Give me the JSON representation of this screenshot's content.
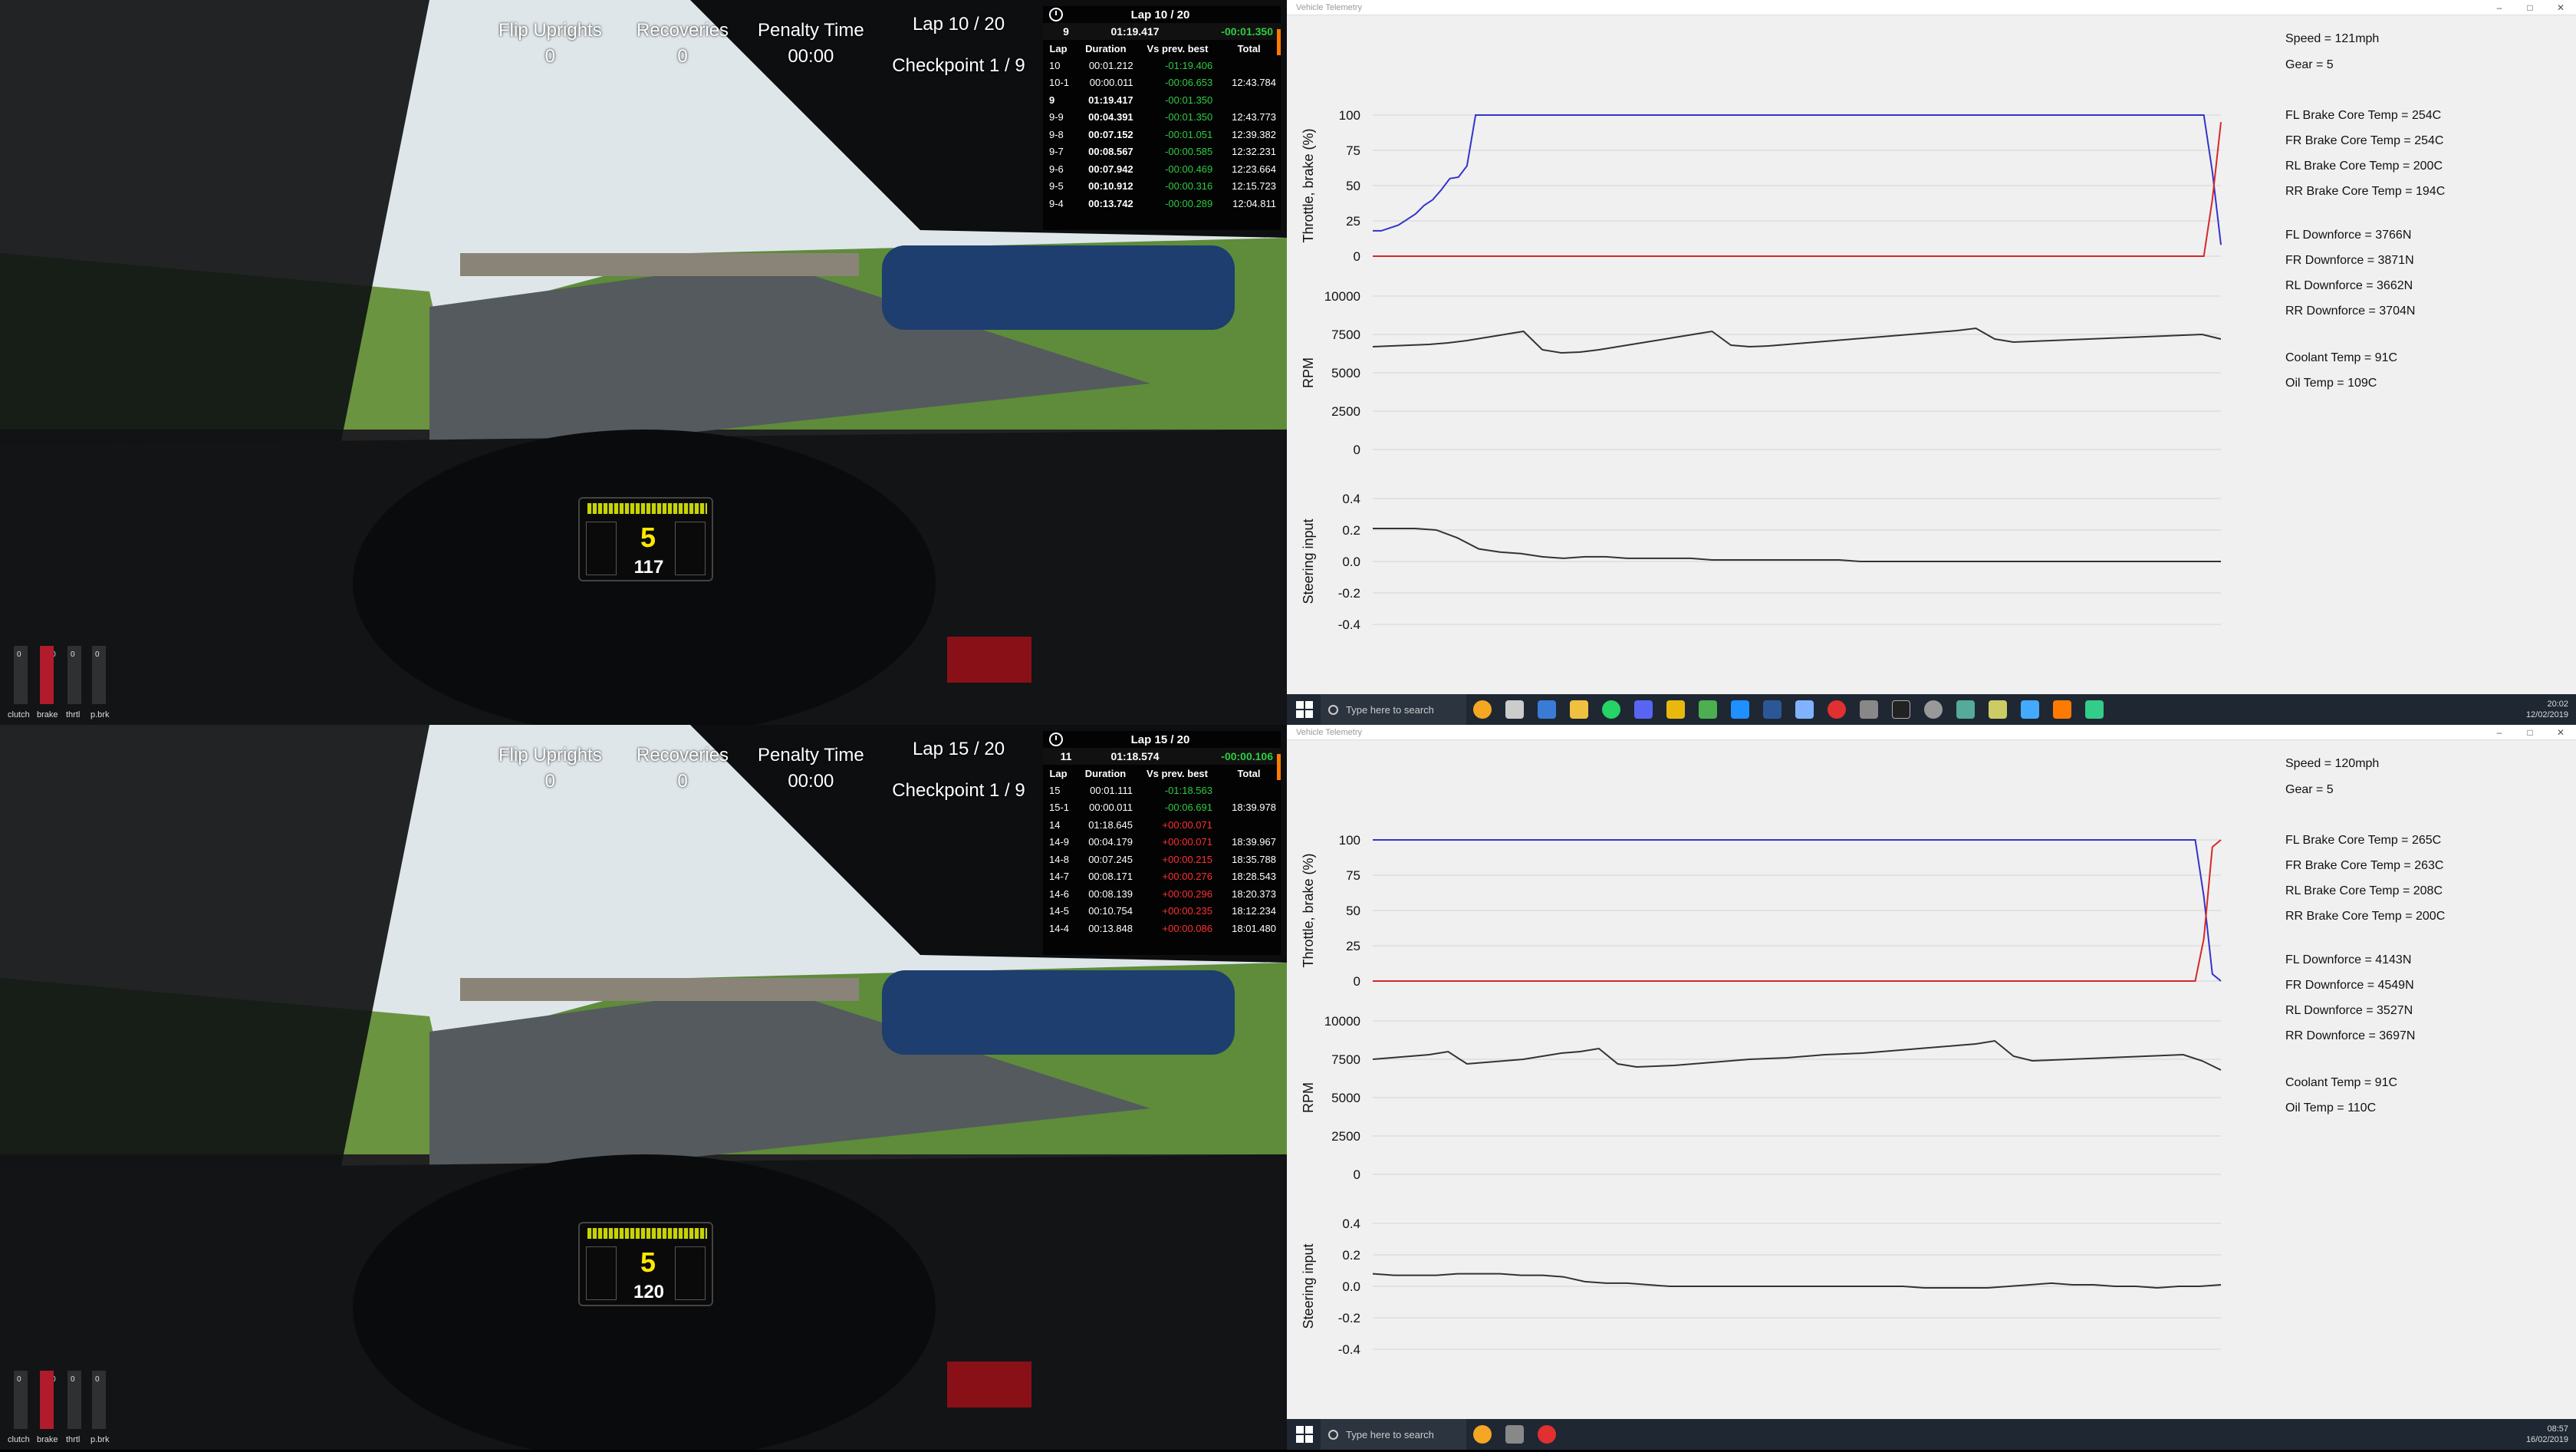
{
  "colors": {
    "throttle": "#3333cc",
    "brake": "#d62728",
    "rpm": "#333333",
    "steering": "#333333",
    "positive_delta": "#2ecc40",
    "negative_delta": "#ff3030",
    "rev_accent": "#c8d400",
    "gear_color": "#ffe800"
  },
  "top": {
    "hud": {
      "flip_uprights_label": "Flip Uprights",
      "flip_uprights_value": "0",
      "recoveries_label": "Recoveries",
      "recoveries_value": "0",
      "penalty_label": "Penalty Time",
      "penalty_value": "00:00",
      "lap": "Lap 10 / 20",
      "checkpoint": "Checkpoint 1 / 9"
    },
    "timing": {
      "header": "Lap 10 / 20",
      "current": {
        "lap": "9",
        "time": "01:19.417",
        "delta": "-00:01.350"
      },
      "columns": [
        "Lap",
        "Duration",
        "Vs prev. best",
        "Total"
      ],
      "rows": [
        {
          "lap": "10",
          "duration": "00:01.212",
          "delta": "-01:19.406",
          "total": ""
        },
        {
          "lap": "10-1",
          "duration": "00:00.011",
          "delta": "-00:06.653",
          "total": "12:43.784"
        },
        {
          "lap": "9",
          "duration": "01:19.417",
          "delta": "-00:01.350",
          "total": ""
        },
        {
          "lap": "9-9",
          "duration": "00:04.391",
          "delta": "-00:01.350",
          "total": "12:43.773"
        },
        {
          "lap": "9-8",
          "duration": "00:07.152",
          "delta": "-00:01.051",
          "total": "12:39.382"
        },
        {
          "lap": "9-7",
          "duration": "00:08.567",
          "delta": "-00:00.585",
          "total": "12:32.231"
        },
        {
          "lap": "9-6",
          "duration": "00:07.942",
          "delta": "-00:00.469",
          "total": "12:23.664"
        },
        {
          "lap": "9-5",
          "duration": "00:10.912",
          "delta": "-00:00.316",
          "total": "12:15.723"
        },
        {
          "lap": "9-4",
          "duration": "00:13.742",
          "delta": "-00:00.289",
          "total": "12:04.811"
        }
      ]
    },
    "dash": {
      "gear": "5",
      "speed": "117"
    },
    "pedals": {
      "labels": [
        "clutch",
        "brake",
        "thrtl",
        "p.brk"
      ],
      "values": [
        "0",
        "100",
        "0",
        "0"
      ]
    },
    "telemetry": {
      "title": "Vehicle Telemetry",
      "readouts_group1": [
        "Speed = 121mph",
        "Gear = 5"
      ],
      "readouts_group2": [
        "FL Brake Core Temp = 254C",
        "FR Brake Core Temp = 254C",
        "RL Brake Core Temp = 200C",
        "RR Brake Core Temp = 194C"
      ],
      "readouts_group3": [
        "FL Downforce = 3766N",
        "FR Downforce = 3871N",
        "RL Downforce = 3662N",
        "RR Downforce = 3704N"
      ],
      "readouts_group4": [
        "Coolant Temp = 91C",
        "Oil Temp = 109C"
      ],
      "taskbar_search": "Type here to search",
      "clock_time": "20:02",
      "clock_date": "12/02/2019"
    }
  },
  "bottom": {
    "hud": {
      "flip_uprights_label": "Flip Uprights",
      "flip_uprights_value": "0",
      "recoveries_label": "Recoveries",
      "recoveries_value": "0",
      "penalty_label": "Penalty Time",
      "penalty_value": "00:00",
      "lap": "Lap 15 / 20",
      "checkpoint": "Checkpoint 1 / 9"
    },
    "timing": {
      "header": "Lap 15 / 20",
      "current": {
        "lap": "11",
        "time": "01:18.574",
        "delta": "-00:00.106"
      },
      "columns": [
        "Lap",
        "Duration",
        "Vs prev. best",
        "Total"
      ],
      "rows": [
        {
          "lap": "15",
          "duration": "00:01.111",
          "delta": "-01:18.563",
          "total": ""
        },
        {
          "lap": "15-1",
          "duration": "00:00.011",
          "delta": "-00:06.691",
          "total": "18:39.978"
        },
        {
          "lap": "14",
          "duration": "01:18.645",
          "delta": "+00:00.071",
          "total": ""
        },
        {
          "lap": "14-9",
          "duration": "00:04.179",
          "delta": "+00:00.071",
          "total": "18:39.967"
        },
        {
          "lap": "14-8",
          "duration": "00:07.245",
          "delta": "+00:00.215",
          "total": "18:35.788"
        },
        {
          "lap": "14-7",
          "duration": "00:08.171",
          "delta": "+00:00.276",
          "total": "18:28.543"
        },
        {
          "lap": "14-6",
          "duration": "00:08.139",
          "delta": "+00:00.296",
          "total": "18:20.373"
        },
        {
          "lap": "14-5",
          "duration": "00:10.754",
          "delta": "+00:00.235",
          "total": "18:12.234"
        },
        {
          "lap": "14-4",
          "duration": "00:13.848",
          "delta": "+00:00.086",
          "total": "18:01.480"
        }
      ]
    },
    "dash": {
      "gear": "5",
      "speed": "120"
    },
    "pedals": {
      "labels": [
        "clutch",
        "brake",
        "thrtl",
        "p.brk"
      ],
      "values": [
        "0",
        "100",
        "0",
        "0"
      ]
    },
    "telemetry": {
      "title": "Vehicle Telemetry",
      "readouts_group1": [
        "Speed = 120mph",
        "Gear = 5"
      ],
      "readouts_group2": [
        "FL Brake Core Temp = 265C",
        "FR Brake Core Temp = 263C",
        "RL Brake Core Temp = 208C",
        "RR Brake Core Temp = 200C"
      ],
      "readouts_group3": [
        "FL Downforce = 4143N",
        "FR Downforce = 4549N",
        "RL Downforce = 3527N",
        "RR Downforce = 3697N"
      ],
      "readouts_group4": [
        "Coolant Temp = 91C",
        "Oil Temp = 110C"
      ],
      "taskbar_search": "Type here to search",
      "clock_time": "08:57",
      "clock_date": "16/02/2019"
    }
  },
  "chart_data": [
    {
      "type": "line",
      "panel": "top",
      "ylabel": "Throttle, brake (%)",
      "ylim": [
        0,
        100
      ],
      "yticks": [
        0,
        25,
        50,
        75,
        100
      ],
      "grid": true,
      "series": [
        {
          "values": [
            18,
            18,
            20,
            22,
            26,
            30,
            36,
            40,
            47,
            55,
            56,
            64,
            100,
            100,
            100,
            100,
            100,
            100,
            100,
            100,
            100,
            100,
            100,
            100,
            100,
            100,
            100,
            100,
            100,
            100,
            100,
            100,
            100,
            100,
            100,
            100,
            100,
            100,
            100,
            100,
            100,
            100,
            100,
            100,
            100,
            100,
            100,
            100,
            100,
            100,
            100,
            100,
            100,
            100,
            100,
            100,
            100,
            100,
            100,
            100,
            100,
            100,
            100,
            100,
            100,
            100,
            100,
            100,
            100,
            100,
            100,
            100,
            100,
            100,
            100,
            100,
            100,
            100,
            100,
            100,
            100,
            100,
            100,
            100,
            100,
            100,
            100,
            100,
            100,
            100,
            100,
            100,
            100,
            100,
            100,
            100,
            100,
            100,
            60,
            8
          ]
        },
        {
          "values": [
            0,
            0,
            0,
            0,
            0,
            0,
            0,
            0,
            0,
            0,
            0,
            0,
            0,
            0,
            0,
            0,
            0,
            0,
            0,
            0,
            0,
            0,
            0,
            0,
            0,
            0,
            0,
            0,
            0,
            0,
            0,
            0,
            0,
            0,
            0,
            0,
            0,
            0,
            0,
            0,
            0,
            0,
            0,
            0,
            0,
            0,
            0,
            0,
            0,
            0,
            0,
            0,
            0,
            0,
            0,
            0,
            0,
            0,
            0,
            0,
            0,
            0,
            0,
            0,
            0,
            0,
            0,
            0,
            0,
            0,
            0,
            0,
            0,
            0,
            0,
            0,
            0,
            0,
            0,
            0,
            0,
            0,
            0,
            0,
            0,
            0,
            0,
            0,
            0,
            0,
            0,
            0,
            0,
            0,
            0,
            0,
            0,
            0,
            40,
            95
          ]
        }
      ]
    },
    {
      "type": "line",
      "panel": "top",
      "ylabel": "RPM",
      "ylim": [
        0,
        10000
      ],
      "yticks": [
        0,
        2500,
        5000,
        7500,
        10000
      ],
      "grid": true,
      "series": [
        {
          "values": [
            6700,
            6750,
            6800,
            6850,
            6950,
            7100,
            7300,
            7500,
            7700,
            6500,
            6300,
            6350,
            6500,
            6700,
            6900,
            7100,
            7300,
            7500,
            7700,
            6800,
            6700,
            6750,
            6850,
            6950,
            7050,
            7150,
            7250,
            7350,
            7450,
            7550,
            7650,
            7750,
            7900,
            7200,
            7000,
            7050,
            7100,
            7150,
            7200,
            7250,
            7300,
            7350,
            7400,
            7450,
            7500,
            7200
          ]
        }
      ]
    },
    {
      "type": "line",
      "panel": "top",
      "ylabel": "Steering input",
      "ylim": [
        -0.4,
        0.4
      ],
      "yticks": [
        -0.4,
        -0.2,
        0.0,
        0.2,
        0.4
      ],
      "grid": true,
      "series": [
        {
          "values": [
            0.21,
            0.21,
            0.21,
            0.2,
            0.15,
            0.08,
            0.06,
            0.05,
            0.03,
            0.02,
            0.03,
            0.03,
            0.02,
            0.02,
            0.02,
            0.02,
            0.01,
            0.01,
            0.01,
            0.01,
            0.01,
            0.01,
            0.01,
            0.0,
            0.0,
            0.0,
            0.0,
            0.0,
            0.0,
            0.0,
            0.0,
            0.0,
            0.0,
            0.0,
            0.0,
            0.0,
            0.0,
            0.0,
            0.0,
            0.0,
            0.0
          ]
        }
      ]
    },
    {
      "type": "line",
      "panel": "bottom",
      "ylabel": "Throttle, brake (%)",
      "ylim": [
        0,
        100
      ],
      "yticks": [
        0,
        25,
        50,
        75,
        100
      ],
      "grid": true,
      "series": [
        {
          "values": [
            100,
            100,
            100,
            100,
            100,
            100,
            100,
            100,
            100,
            100,
            100,
            100,
            100,
            100,
            100,
            100,
            100,
            100,
            100,
            100,
            100,
            100,
            100,
            100,
            100,
            100,
            100,
            100,
            100,
            100,
            100,
            100,
            100,
            100,
            100,
            100,
            100,
            100,
            100,
            100,
            100,
            100,
            100,
            100,
            100,
            100,
            100,
            100,
            100,
            100,
            100,
            100,
            100,
            100,
            100,
            100,
            100,
            100,
            100,
            100,
            100,
            100,
            100,
            100,
            100,
            100,
            100,
            100,
            100,
            100,
            100,
            100,
            100,
            100,
            100,
            100,
            100,
            100,
            100,
            100,
            100,
            100,
            100,
            100,
            100,
            100,
            100,
            100,
            100,
            100,
            100,
            100,
            100,
            100,
            100,
            100,
            100,
            60,
            5,
            0
          ]
        },
        {
          "values": [
            0,
            0,
            0,
            0,
            0,
            0,
            0,
            0,
            0,
            0,
            0,
            0,
            0,
            0,
            0,
            0,
            0,
            0,
            0,
            0,
            0,
            0,
            0,
            0,
            0,
            0,
            0,
            0,
            0,
            0,
            0,
            0,
            0,
            0,
            0,
            0,
            0,
            0,
            0,
            0,
            0,
            0,
            0,
            0,
            0,
            0,
            0,
            0,
            0,
            0,
            0,
            0,
            0,
            0,
            0,
            0,
            0,
            0,
            0,
            0,
            0,
            0,
            0,
            0,
            0,
            0,
            0,
            0,
            0,
            0,
            0,
            0,
            0,
            0,
            0,
            0,
            0,
            0,
            0,
            0,
            0,
            0,
            0,
            0,
            0,
            0,
            0,
            0,
            0,
            0,
            0,
            0,
            0,
            0,
            0,
            0,
            0,
            30,
            95,
            100
          ]
        }
      ]
    },
    {
      "type": "line",
      "panel": "bottom",
      "ylabel": "RPM",
      "ylim": [
        0,
        10000
      ],
      "yticks": [
        0,
        2500,
        5000,
        7500,
        10000
      ],
      "grid": true,
      "series": [
        {
          "values": [
            7500,
            7600,
            7700,
            7800,
            8000,
            7200,
            7300,
            7400,
            7500,
            7700,
            7900,
            8000,
            8200,
            7200,
            7000,
            7050,
            7100,
            7200,
            7300,
            7400,
            7500,
            7550,
            7600,
            7700,
            7800,
            7850,
            7900,
            8000,
            8100,
            8200,
            8300,
            8400,
            8500,
            8700,
            7700,
            7400,
            7450,
            7500,
            7550,
            7600,
            7650,
            7700,
            7750,
            7800,
            7400,
            6800
          ]
        }
      ]
    },
    {
      "type": "line",
      "panel": "bottom",
      "ylabel": "Steering input",
      "ylim": [
        -0.4,
        0.4
      ],
      "yticks": [
        -0.4,
        -0.2,
        0.0,
        0.2,
        0.4
      ],
      "grid": true,
      "series": [
        {
          "values": [
            0.08,
            0.07,
            0.07,
            0.07,
            0.08,
            0.08,
            0.08,
            0.07,
            0.07,
            0.06,
            0.03,
            0.02,
            0.02,
            0.01,
            0.0,
            0.0,
            0.0,
            0.0,
            0.0,
            0.0,
            0.0,
            0.0,
            0.0,
            0.0,
            0.0,
            0.0,
            -0.01,
            -0.01,
            -0.01,
            -0.01,
            0.0,
            0.01,
            0.02,
            0.01,
            0.01,
            0.0,
            0.0,
            -0.01,
            0.0,
            0.0,
            0.01
          ]
        }
      ]
    }
  ]
}
